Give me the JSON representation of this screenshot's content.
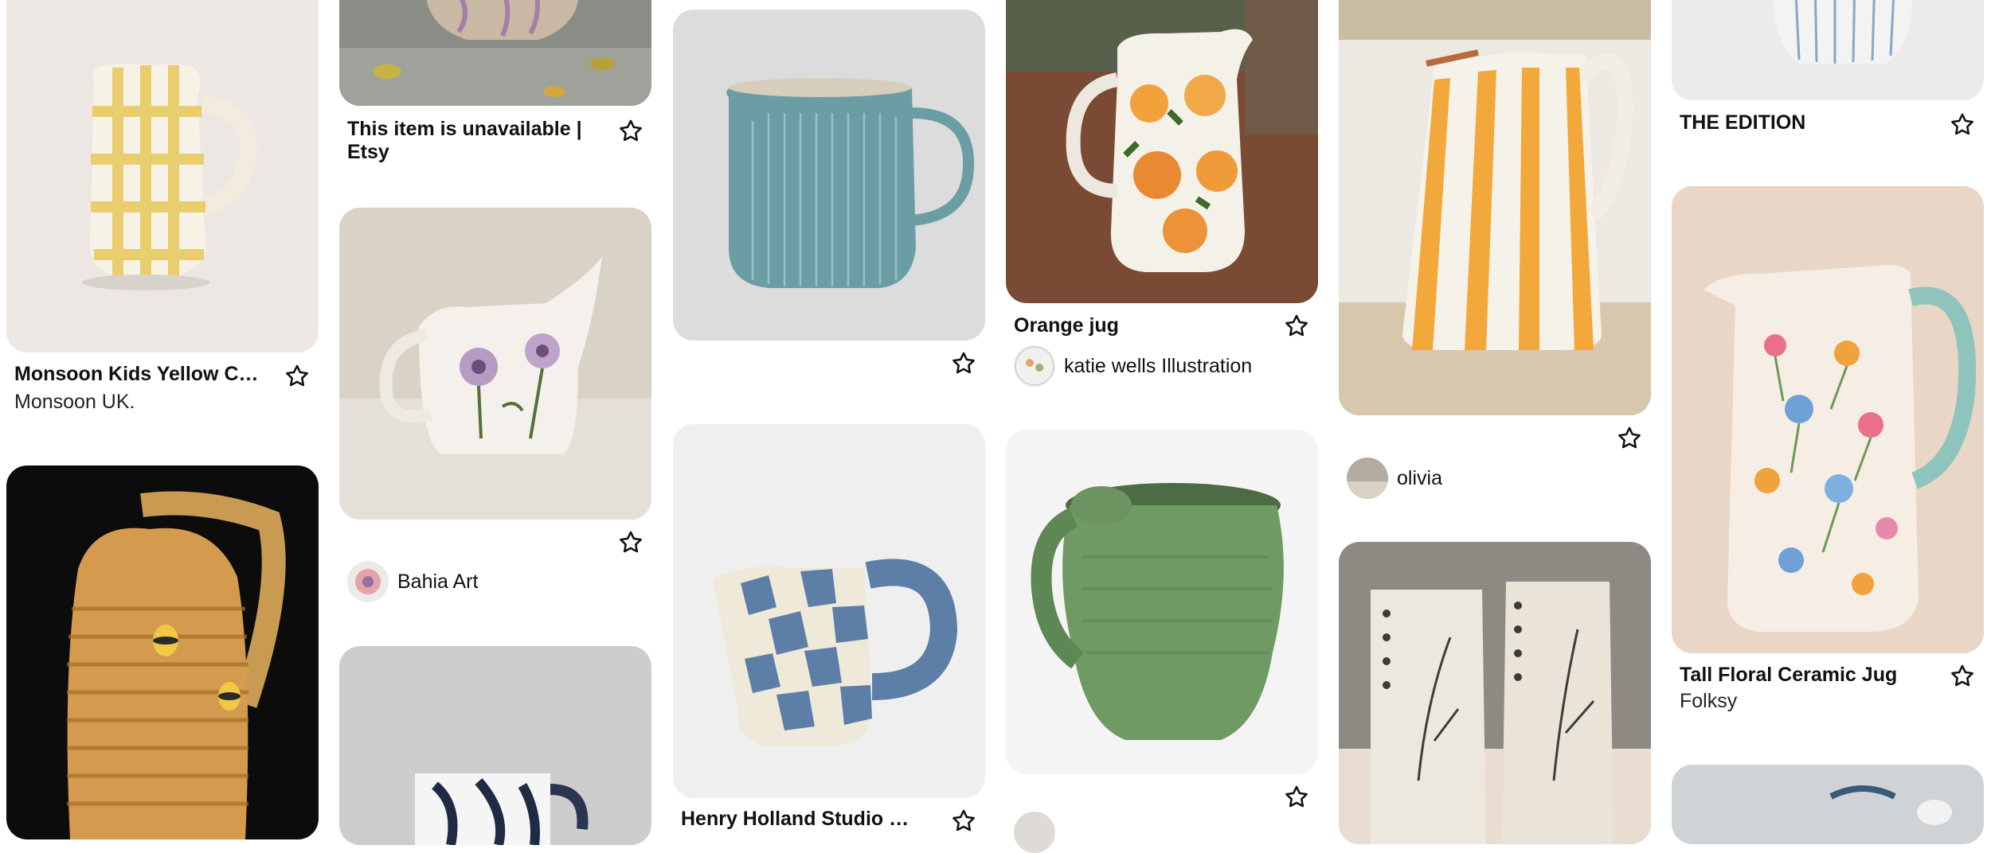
{
  "pins": [
    {
      "id": "yellow-check-jug",
      "title": "Monsoon Kids Yellow Che...",
      "source": "Monsoon UK."
    },
    {
      "id": "unavailable-item",
      "title": "This item is unavailable | Etsy"
    },
    {
      "id": "floral-jug-bahia",
      "user": "Bahia Art"
    },
    {
      "id": "blue-striped-jug"
    },
    {
      "id": "checker-jug",
      "title": "Henry Holland Studio Blue..."
    },
    {
      "id": "orange-jug",
      "title": "Orange jug",
      "user": "katie wells Illustration"
    },
    {
      "id": "orange-stripe-jug",
      "user": "olivia"
    },
    {
      "id": "the-edition-jug",
      "title": "THE EDITION"
    },
    {
      "id": "tall-floral-jug",
      "title": "Tall Floral Ceramic Jug",
      "source": "Folksy"
    }
  ],
  "colors": {
    "background": "#ffffff",
    "text": "#111111",
    "star_icon": "#111111"
  }
}
